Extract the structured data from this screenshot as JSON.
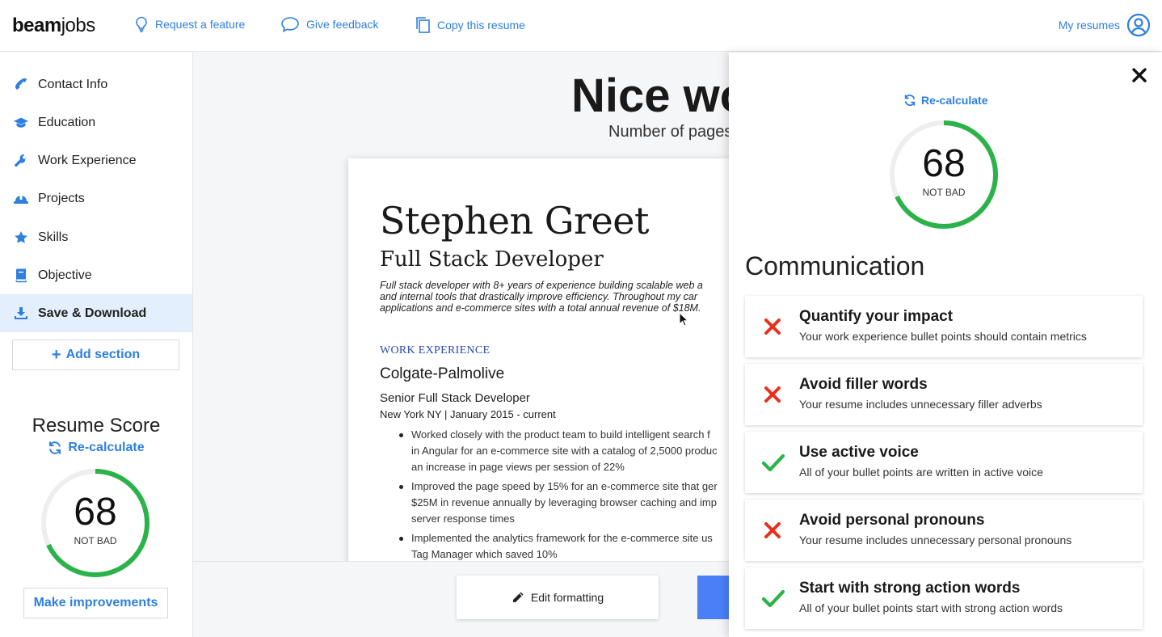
{
  "header": {
    "logo_bold": "beam",
    "logo_light": "jobs",
    "links": [
      {
        "label": "Request a feature",
        "icon": "lightbulb-icon"
      },
      {
        "label": "Give feedback",
        "icon": "chat-bubble-icon"
      },
      {
        "label": "Copy this resume",
        "icon": "copy-icon"
      }
    ],
    "my_resumes": "My resumes"
  },
  "sidebar": {
    "items": [
      {
        "label": "Contact Info",
        "icon": "phone-icon"
      },
      {
        "label": "Education",
        "icon": "graduation-cap-icon"
      },
      {
        "label": "Work Experience",
        "icon": "wrench-icon"
      },
      {
        "label": "Projects",
        "icon": "hard-hat-icon"
      },
      {
        "label": "Skills",
        "icon": "star-icon"
      },
      {
        "label": "Objective",
        "icon": "book-icon"
      },
      {
        "label": "Save & Download",
        "icon": "download-icon",
        "active": true
      }
    ],
    "add_section": "Add section",
    "score_title": "Resume Score",
    "recalculate": "Re-calculate",
    "score": "68",
    "score_label": "NOT BAD",
    "score_fraction": 0.68,
    "make_improvements": "Make improvements"
  },
  "main": {
    "heading": "Nice wo",
    "pages_text": "Number of pages",
    "resume": {
      "name": "Stephen Greet",
      "role": "Full Stack Developer",
      "summary": [
        "Full stack developer with 8+ years of experience building scalable web a",
        "and internal tools that drastically improve efficiency. Throughout my car",
        "applications and e-commerce sites with a total annual revenue of $18M."
      ],
      "section": "WORK EXPERIENCE",
      "company": "Colgate-Palmolive",
      "job_title": "Senior Full Stack Developer",
      "location": "New York NY  |  January 2015 - current",
      "bullets": [
        "Worked closely with the product team to build intelligent search f\nin Angular for an e-commerce site with a catalog of 2,5000 produc\nan increase in page views per session of 22%",
        "Improved the page speed by 15% for an e-commerce site that ger\n$25M in revenue annually by leveraging browser caching and imp\nserver response times",
        "Implemented the analytics framework for the e-commerce site us\nTag Manager which saved 10%"
      ]
    },
    "edit_formatting": "Edit formatting"
  },
  "panel": {
    "recalculate": "Re-calculate",
    "score": "68",
    "score_label": "NOT BAD",
    "score_fraction": 0.68,
    "heading": "Communication",
    "checks": [
      {
        "title": "Quantify your impact",
        "desc": "Your work experience bullet points should contain metrics",
        "status": "fail"
      },
      {
        "title": "Avoid filler words",
        "desc": "Your resume includes unnecessary filler adverbs",
        "status": "fail"
      },
      {
        "title": "Use active voice",
        "desc": "All of your bullet points are written in active voice",
        "status": "pass"
      },
      {
        "title": "Avoid personal pronouns",
        "desc": "Your resume includes unnecessary personal pronouns",
        "status": "fail"
      },
      {
        "title": "Start with strong action words",
        "desc": "All of your bullet points start with strong action words",
        "status": "pass"
      }
    ]
  },
  "colors": {
    "accent": "#2f7fe0",
    "gauge_green": "#2bb34a",
    "fail_red": "#e8301c",
    "pass_green": "#2bb34a",
    "resume_section_blue": "#2a4bb0"
  }
}
